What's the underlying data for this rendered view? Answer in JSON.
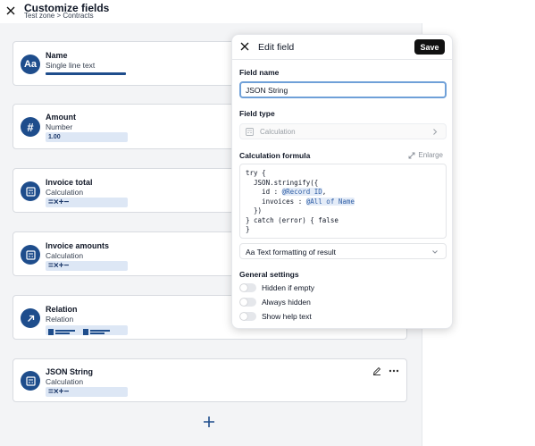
{
  "header": {
    "title": "Customize fields",
    "breadcrumb": "Test zone > Contracts"
  },
  "fields": [
    {
      "name": "Name",
      "type": "Single line text",
      "icon": "text-icon",
      "glyph": "Aa"
    },
    {
      "name": "Amount",
      "type": "Number",
      "icon": "hash-icon",
      "glyph": "#",
      "preview": "1.00"
    },
    {
      "name": "Invoice total",
      "type": "Calculation",
      "icon": "calculator-icon",
      "preview": "=×+−"
    },
    {
      "name": "Invoice amounts",
      "type": "Calculation",
      "icon": "calculator-icon",
      "preview": "=×+−"
    },
    {
      "name": "Relation",
      "type": "Relation",
      "icon": "arrow-up-right-icon"
    },
    {
      "name": "JSON String",
      "type": "Calculation",
      "icon": "calculator-icon",
      "preview": "=×+−"
    }
  ],
  "editor": {
    "title": "Edit field",
    "save_label": "Save",
    "field_name_label": "Field name",
    "field_name_value": "JSON String",
    "field_type_label": "Field type",
    "field_type_value": "Calculation",
    "formula_label": "Calculation formula",
    "enlarge_label": "Enlarge",
    "formula_lines": {
      "l1": "try {",
      "l2": "  JSON.stringify({",
      "l3_pre": "    id : ",
      "l3_tag": "@Record ID",
      "l3_post": ",",
      "l4_pre": "    invoices : ",
      "l4_tag": "@All of Name",
      "l5": "  })",
      "l6": "} catch (error) { false",
      "l7": "}"
    },
    "format_label": "Aa Text formatting of result",
    "general_label": "General settings",
    "toggles": [
      {
        "label": "Hidden if empty",
        "on": false
      },
      {
        "label": "Always hidden",
        "on": false
      },
      {
        "label": "Show help text",
        "on": false
      }
    ]
  },
  "colors": {
    "accent": "#1e4d8c",
    "tag_bg": "#e4ecf8",
    "tag_text": "#2f5ea5"
  }
}
